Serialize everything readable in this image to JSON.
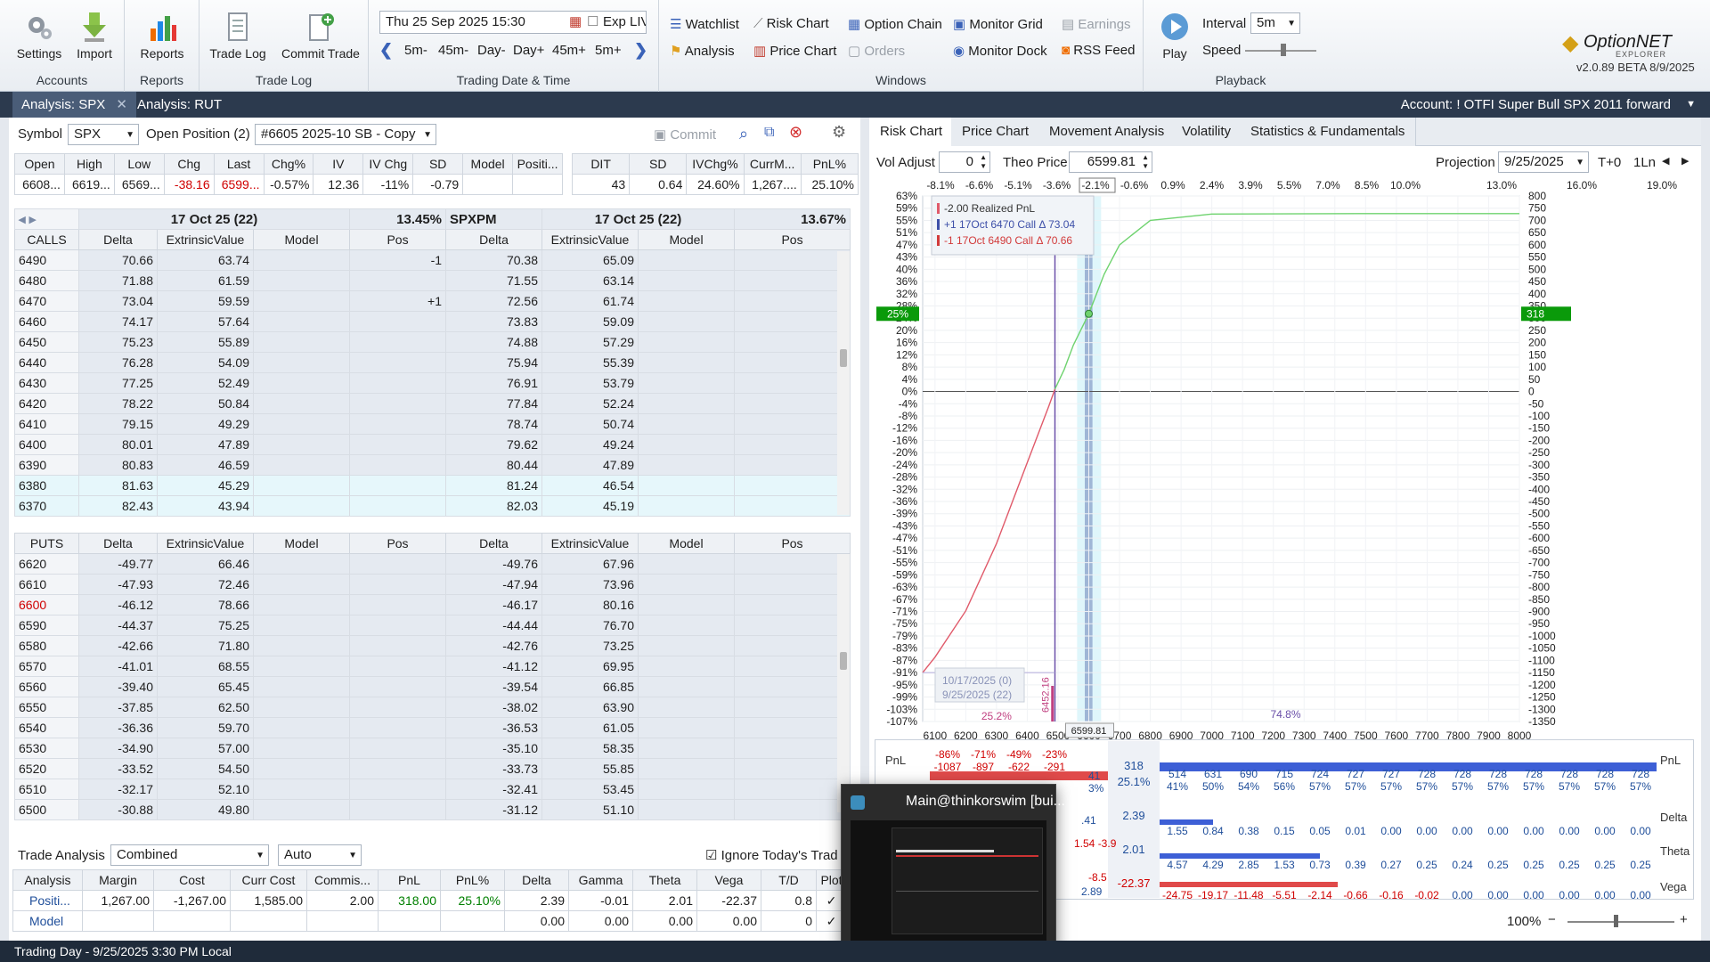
{
  "ribbon": {
    "accounts": {
      "settings": "Settings",
      "import": "Import",
      "group": "Accounts"
    },
    "reports": {
      "reports": "Reports",
      "group": "Reports"
    },
    "tradelog": {
      "trade_log": "Trade Log",
      "commit_trade": "Commit Trade",
      "group": "Trade Log"
    },
    "datetime": {
      "value": "Thu 25 Sep 2025 15:30",
      "exp_live": "Exp LIVE",
      "steps": [
        "5m-",
        "45m-",
        "Day-",
        "Day+",
        "45m+",
        "5m+"
      ],
      "group": "Trading Date & Time"
    },
    "windows": {
      "watchlist": "Watchlist",
      "risk_chart": "Risk Chart",
      "option_chain": "Option Chain",
      "monitor_grid": "Monitor Grid",
      "earnings": "Earnings",
      "analysis": "Analysis",
      "price_chart": "Price Chart",
      "orders": "Orders",
      "monitor_dock": "Monitor Dock",
      "rss_feed": "RSS Feed",
      "group": "Windows"
    },
    "playback": {
      "play": "Play",
      "interval_label": "Interval",
      "interval_value": "5m",
      "speed_label": "Speed",
      "group": "Playback"
    },
    "logo": {
      "name": "OptionNET",
      "sub": "EXPLORER",
      "version": "v2.0.89 BETA 8/9/2025"
    }
  },
  "tabs": [
    {
      "label": "Analysis: SPX"
    },
    {
      "label": "Analysis: RUT"
    }
  ],
  "account": "Account: ! OTFI Super Bull SPX  2011 forward",
  "left": {
    "symbol_label": "Symbol",
    "symbol": "SPX",
    "open_position_label": "Open Position (2)",
    "position": "#6605 2025-10 SB - Copy",
    "commit": "Commit",
    "quote_headers": [
      "Open",
      "High",
      "Low",
      "Chg",
      "Last",
      "Chg%",
      "IV",
      "IV Chg",
      "SD",
      "Model",
      "Positi..."
    ],
    "quote_values": [
      "6608...",
      "6619...",
      "6569...",
      "-38.16",
      "6599...",
      "-0.57%",
      "12.36",
      "-11%",
      "-0.79",
      "",
      ""
    ],
    "stats_headers": [
      "DIT",
      "SD",
      "IVChg%",
      "CurrM...",
      "PnL%"
    ],
    "stats_values": [
      "43",
      "0.64",
      "24.60%",
      "1,267....",
      "25.10%"
    ],
    "chain_left": {
      "exp": "17 Oct 25 (22)",
      "iv": "13.45%"
    },
    "chain_right": {
      "root": "SPXPM",
      "exp": "17 Oct 25 (22)",
      "iv": "13.67%"
    },
    "calls_label": "CALLS",
    "puts_label": "PUTS",
    "col_headers": [
      "Delta",
      "ExtrinsicValue",
      "Model",
      "Pos"
    ],
    "calls": [
      {
        "strike": "6490",
        "d1": "70.66",
        "e1": "63.74",
        "p1": "-1",
        "d2": "70.38",
        "e2": "65.09"
      },
      {
        "strike": "6480",
        "d1": "71.88",
        "e1": "61.59",
        "p1": "",
        "d2": "71.55",
        "e2": "63.14"
      },
      {
        "strike": "6470",
        "d1": "73.04",
        "e1": "59.59",
        "p1": "+1",
        "d2": "72.56",
        "e2": "61.74"
      },
      {
        "strike": "6460",
        "d1": "74.17",
        "e1": "57.64",
        "p1": "",
        "d2": "73.83",
        "e2": "59.09"
      },
      {
        "strike": "6450",
        "d1": "75.23",
        "e1": "55.89",
        "p1": "",
        "d2": "74.88",
        "e2": "57.29"
      },
      {
        "strike": "6440",
        "d1": "76.28",
        "e1": "54.09",
        "p1": "",
        "d2": "75.94",
        "e2": "55.39"
      },
      {
        "strike": "6430",
        "d1": "77.25",
        "e1": "52.49",
        "p1": "",
        "d2": "76.91",
        "e2": "53.79"
      },
      {
        "strike": "6420",
        "d1": "78.22",
        "e1": "50.84",
        "p1": "",
        "d2": "77.84",
        "e2": "52.24"
      },
      {
        "strike": "6410",
        "d1": "79.15",
        "e1": "49.29",
        "p1": "",
        "d2": "78.74",
        "e2": "50.74"
      },
      {
        "strike": "6400",
        "d1": "80.01",
        "e1": "47.89",
        "p1": "",
        "d2": "79.62",
        "e2": "49.24"
      },
      {
        "strike": "6390",
        "d1": "80.83",
        "e1": "46.59",
        "p1": "",
        "d2": "80.44",
        "e2": "47.89"
      },
      {
        "strike": "6380",
        "d1": "81.63",
        "e1": "45.29",
        "p1": "",
        "d2": "81.24",
        "e2": "46.54"
      },
      {
        "strike": "6370",
        "d1": "82.43",
        "e1": "43.94",
        "p1": "",
        "d2": "82.03",
        "e2": "45.19"
      }
    ],
    "puts": [
      {
        "strike": "6620",
        "d1": "-49.77",
        "e1": "66.46",
        "d2": "-49.76",
        "e2": "67.96"
      },
      {
        "strike": "6610",
        "d1": "-47.93",
        "e1": "72.46",
        "d2": "-47.94",
        "e2": "73.96"
      },
      {
        "strike": "6600",
        "d1": "-46.12",
        "e1": "78.66",
        "d2": "-46.17",
        "e2": "80.16"
      },
      {
        "strike": "6590",
        "d1": "-44.37",
        "e1": "75.25",
        "d2": "-44.44",
        "e2": "76.70"
      },
      {
        "strike": "6580",
        "d1": "-42.66",
        "e1": "71.80",
        "d2": "-42.76",
        "e2": "73.25"
      },
      {
        "strike": "6570",
        "d1": "-41.01",
        "e1": "68.55",
        "d2": "-41.12",
        "e2": "69.95"
      },
      {
        "strike": "6560",
        "d1": "-39.40",
        "e1": "65.45",
        "d2": "-39.54",
        "e2": "66.85"
      },
      {
        "strike": "6550",
        "d1": "-37.85",
        "e1": "62.50",
        "d2": "-38.02",
        "e2": "63.90"
      },
      {
        "strike": "6540",
        "d1": "-36.36",
        "e1": "59.70",
        "d2": "-36.53",
        "e2": "61.05"
      },
      {
        "strike": "6530",
        "d1": "-34.90",
        "e1": "57.00",
        "d2": "-35.10",
        "e2": "58.35"
      },
      {
        "strike": "6520",
        "d1": "-33.52",
        "e1": "54.50",
        "d2": "-33.73",
        "e2": "55.85"
      },
      {
        "strike": "6510",
        "d1": "-32.17",
        "e1": "52.10",
        "d2": "-32.41",
        "e2": "53.45"
      },
      {
        "strike": "6500",
        "d1": "-30.88",
        "e1": "49.80",
        "d2": "-31.12",
        "e2": "51.10"
      }
    ],
    "trade_analysis": {
      "label": "Trade Analysis",
      "mode": "Combined",
      "auto": "Auto",
      "ignore": "Ignore Today's Trad",
      "headers": [
        "Analysis",
        "Margin",
        "Cost",
        "Curr Cost",
        "Commis...",
        "PnL",
        "PnL%",
        "Delta",
        "Gamma",
        "Theta",
        "Vega",
        "T/D",
        "Plot"
      ],
      "rows": [
        [
          "Positi...",
          "1,267.00",
          "-1,267.00",
          "1,585.00",
          "2.00",
          "318.00",
          "25.10%",
          "2.39",
          "-0.01",
          "2.01",
          "-22.37",
          "0.8",
          "✓"
        ],
        [
          "Model",
          "",
          "",
          "",
          "",
          "",
          "",
          "0.00",
          "0.00",
          "0.00",
          "0.00",
          "0",
          "✓"
        ]
      ]
    }
  },
  "right": {
    "tabs": [
      "Risk Chart",
      "Price Chart",
      "Movement Analysis",
      "Volatility",
      "Statistics & Fundamentals"
    ],
    "vol_adjust_label": "Vol Adjust",
    "vol_adjust": "0",
    "theo_label": "Theo Price",
    "theo": "6599.81",
    "projection_label": "Projection",
    "projection": "9/25/2025",
    "t0": "T+0",
    "lines": "1Ln",
    "move_pct": [
      "-8.1%",
      "-6.6%",
      "-5.1%",
      "-3.6%",
      "-2.1%",
      "-0.6%",
      "0.9%",
      "2.4%",
      "3.9%",
      "5.5%",
      "7.0%",
      "8.5%",
      "10.0%",
      "13.0%",
      "16.0%",
      "19.0%"
    ],
    "legend": [
      "-2.00 Realized PnL",
      "+1 17Oct 6470 Call Δ  73.04",
      "-1 17Oct 6490 Call Δ  70.66"
    ],
    "date_labels": [
      "10/17/2025 (0)",
      "9/25/2025 (22)"
    ],
    "marker_labels": [
      "6452.16",
      "25.2%",
      "74.8%"
    ],
    "current_price": "6599.81",
    "pnl_badge_pct": "25%",
    "pnl_badge_val": "318",
    "zoom": "100%",
    "bottom_labels": [
      "PnL",
      "Delta",
      "Theta",
      "Vega"
    ],
    "pnl_neg_pct": [
      "-86%",
      "-71%",
      "-49%",
      "-23%"
    ],
    "pnl_neg_val": [
      "-1087",
      "-897",
      "-622",
      "-291"
    ],
    "pnl_pos_val": [
      "514",
      "631",
      "690",
      "715",
      "724",
      "727",
      "727",
      "728",
      "728",
      "728",
      "728",
      "728",
      "728",
      "728"
    ],
    "pnl_pos_pct": [
      "41%",
      "50%",
      "54%",
      "56%",
      "57%",
      "57%",
      "57%",
      "57%",
      "57%",
      "57%",
      "57%",
      "57%",
      "57%",
      "57%"
    ],
    "delta_vals": [
      "1.55",
      "0.84",
      "0.38",
      "0.15",
      "0.05",
      "0.01",
      "0.00",
      "0.00",
      "0.00",
      "0.00",
      "0.00",
      "0.00",
      "0.00",
      "0.00"
    ],
    "theta_vals": [
      "4.57",
      "4.29",
      "2.85",
      "1.53",
      "0.73",
      "0.39",
      "0.27",
      "0.25",
      "0.24",
      "0.25",
      "0.25",
      "0.25",
      "0.25",
      "0.25"
    ],
    "vega_vals": [
      "-24.75",
      "-19.17",
      "-11.48",
      "-5.51",
      "-2.14",
      "-0.66",
      "-0.16",
      "-0.02",
      "0.00",
      "0.00",
      "0.00",
      "0.00",
      "0.00",
      "0.00"
    ],
    "center_col": {
      "pnl": "318",
      "pnl_pct": "25.1%",
      "delta": "2.39",
      "theta": "2.01",
      "vega": "-22.37"
    },
    "partial": {
      "p1": "41",
      "p2": "3%",
      "d": ".41",
      "t": "1.54 -3.9",
      "v": "2.89",
      "v2": "-8.5"
    }
  },
  "popup": {
    "title": "Main@thinkorswim [bui..."
  },
  "status": "Trading Day - 9/25/2025 3:30 PM Local",
  "chart_data": {
    "type": "line",
    "xlabel": "",
    "ylabel": "",
    "x_ticks": [
      6100,
      6200,
      6300,
      6400,
      6500,
      6600,
      6700,
      6800,
      6900,
      7000,
      7100,
      7200,
      7300,
      7400,
      7500,
      7600,
      7700,
      7800,
      7900,
      8000
    ],
    "xlim": [
      6060,
      8000
    ],
    "ylim_pnl": [
      -1350,
      800
    ],
    "y_left_ticks": [
      "63%",
      "59%",
      "55%",
      "51%",
      "47%",
      "43%",
      "40%",
      "36%",
      "32%",
      "28%",
      "24%",
      "20%",
      "16%",
      "12%",
      "8%",
      "4%",
      "0%",
      "-4%",
      "-8%",
      "-12%",
      "-16%",
      "-20%",
      "-24%",
      "-28%",
      "-32%",
      "-36%",
      "-39%",
      "-43%",
      "-47%",
      "-51%",
      "-55%",
      "-59%",
      "-63%",
      "-67%",
      "-71%",
      "-75%",
      "-79%",
      "-83%",
      "-87%",
      "-91%",
      "-95%",
      "-99%",
      "-103%",
      "-107%"
    ],
    "y_right_ticks": [
      800,
      750,
      700,
      650,
      600,
      550,
      500,
      450,
      400,
      350,
      300,
      250,
      200,
      150,
      100,
      50,
      0,
      -50,
      -100,
      -150,
      -200,
      -250,
      -300,
      -350,
      -400,
      -450,
      -500,
      -550,
      -600,
      -650,
      -700,
      -750,
      -800,
      -850,
      -900,
      -950,
      -1000,
      -1050,
      -1100,
      -1150,
      -1200,
      -1250,
      -1300,
      -1350
    ],
    "series": [
      {
        "color": "#e05a6a",
        "x": [
          6060,
          6100,
          6200,
          6300,
          6400,
          6470,
          6490
        ],
        "y": [
          -1150,
          -1087,
          -897,
          -622,
          -291,
          -60,
          10
        ]
      },
      {
        "color": "#6fd36f",
        "x": [
          6490,
          6520,
          6550,
          6600,
          6650,
          6700,
          6800,
          7000,
          7500,
          8000
        ],
        "y": [
          10,
          90,
          190,
          318,
          480,
          600,
          700,
          726,
          728,
          728
        ]
      }
    ]
  }
}
